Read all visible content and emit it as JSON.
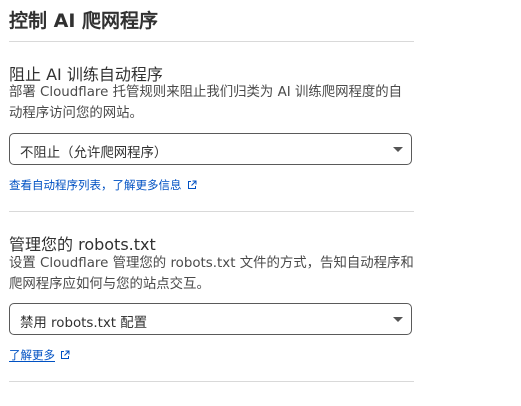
{
  "page": {
    "title": "控制 AI 爬网程序"
  },
  "sections": [
    {
      "title": "阻止 AI 训练自动程序",
      "description": "部署 Cloudflare 托管规则来阻止我们归类为 AI 训练爬网程度的自动程序访问您的网站。",
      "select_value": "不阻止（允许爬网程序）",
      "link_label": "查看自动程序列表，了解更多信息",
      "link_icon": "external-link-icon"
    },
    {
      "title": "管理您的 robots.txt",
      "description": "设置 Cloudflare 管理您的 robots.txt 文件的方式，告知自动程序和爬网程序应如何与您的站点交互。",
      "select_value": "禁用 robots.txt 配置",
      "link_label": "了解更多",
      "link_icon": "external-link-icon"
    }
  ],
  "colors": {
    "link": "#0051c3",
    "text": "#313131",
    "divider": "#d9d9d9"
  }
}
